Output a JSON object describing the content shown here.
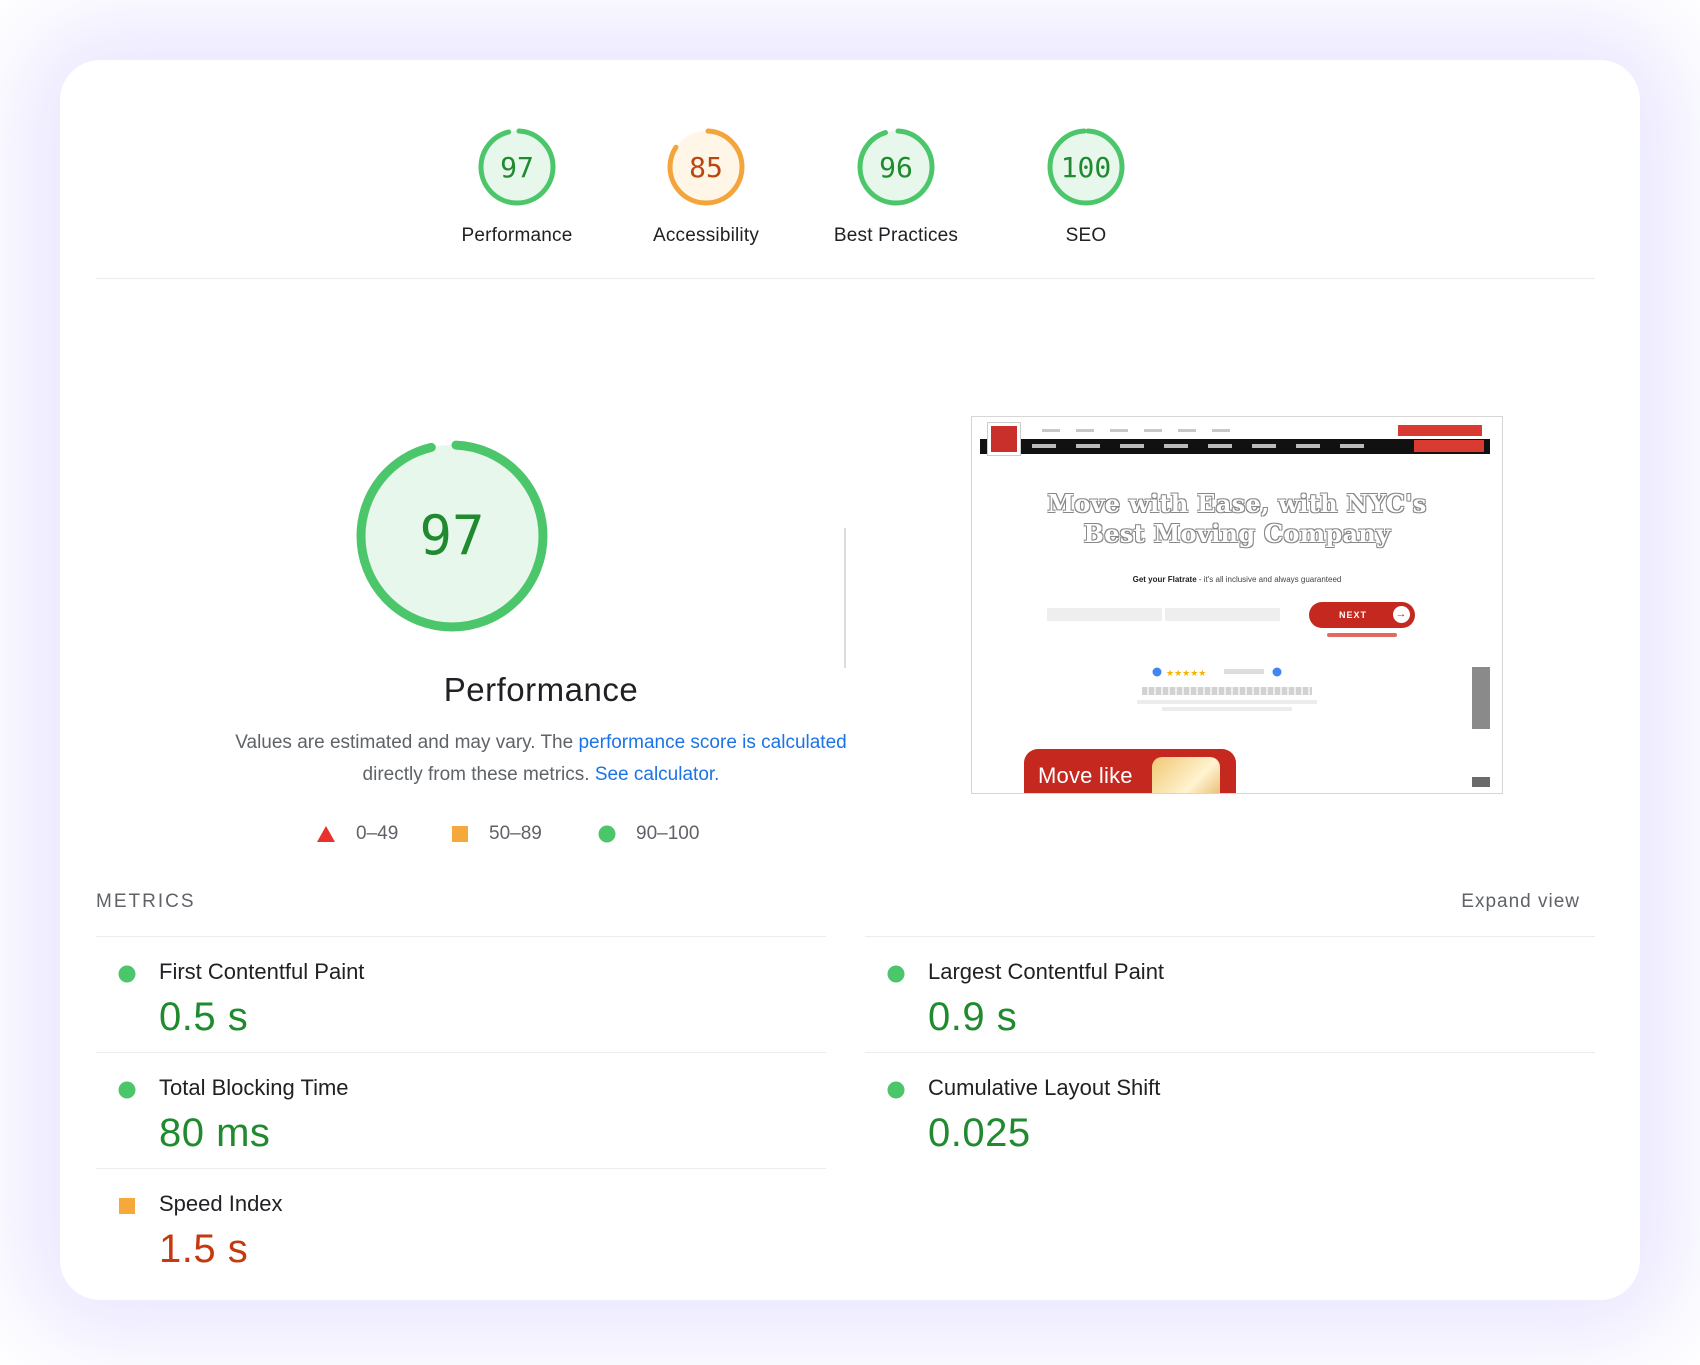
{
  "colors": {
    "pass": "#0cce6b",
    "pass_text": "#1f8a2e",
    "average": "#ffa400",
    "average_text": "#c33300",
    "fail": "#ff4e42",
    "link": "#1a73e8"
  },
  "gauges": [
    {
      "label": "Performance",
      "score": "97",
      "value": 97,
      "rating": "pass"
    },
    {
      "label": "Accessibility",
      "score": "85",
      "value": 85,
      "rating": "average"
    },
    {
      "label": "Best Practices",
      "score": "96",
      "value": 96,
      "rating": "pass"
    },
    {
      "label": "SEO",
      "score": "100",
      "value": 100,
      "rating": "pass"
    }
  ],
  "performance": {
    "score": "97",
    "value": 97,
    "title": "Performance",
    "desc_prefix": "Values are estimated and may vary. The ",
    "link_score": "performance score is calculated",
    "desc_middle": " directly from these metrics. ",
    "link_calc": "See calculator."
  },
  "legend": [
    {
      "shape": "triangle",
      "range": "0–49"
    },
    {
      "shape": "square",
      "range": "50–89"
    },
    {
      "shape": "circle",
      "range": "90–100"
    }
  ],
  "screenshot": {
    "headline_line1": "Move with Ease, with NYC's",
    "headline_line2": "Best Moving Company",
    "sub_bold": "Get your Flatrate",
    "sub_rest": " - it's all inclusive and always guaranteed",
    "next_label": "NEXT",
    "promo_text": "Move like"
  },
  "metrics": {
    "heading": "METRICS",
    "expand_label": "Expand view",
    "items": [
      {
        "name": "First Contentful Paint",
        "value": "0.5 s",
        "rating": "pass"
      },
      {
        "name": "Largest Contentful Paint",
        "value": "0.9 s",
        "rating": "pass"
      },
      {
        "name": "Total Blocking Time",
        "value": "80 ms",
        "rating": "pass"
      },
      {
        "name": "Cumulative Layout Shift",
        "value": "0.025",
        "rating": "pass"
      },
      {
        "name": "Speed Index",
        "value": "1.5 s",
        "rating": "average"
      }
    ]
  }
}
